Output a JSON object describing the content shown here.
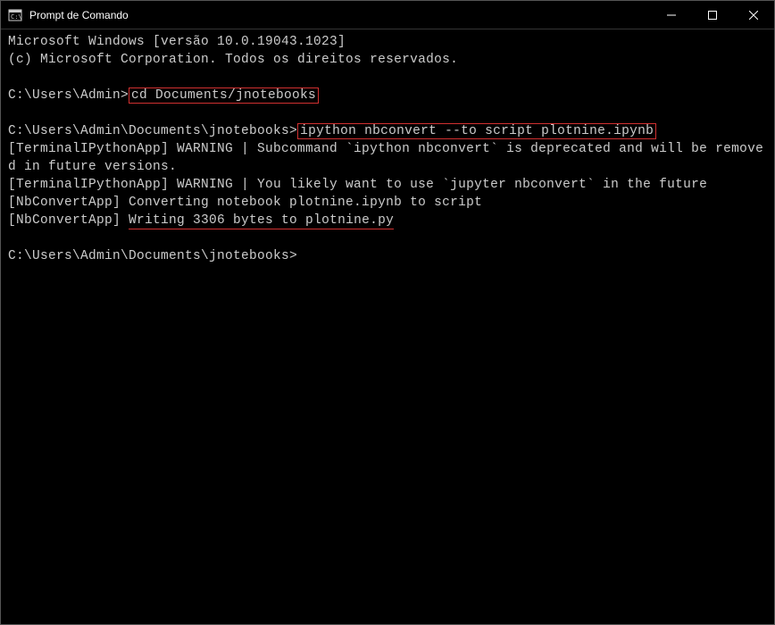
{
  "window": {
    "title": "Prompt de Comando"
  },
  "terminal": {
    "lines": {
      "l1": "Microsoft Windows [versão 10.0.19043.1023]",
      "l2": "(c) Microsoft Corporation. Todos os direitos reservados.",
      "l3_prompt": "C:\\Users\\Admin>",
      "l3_cmd": "cd Documents/jnotebooks",
      "l4_prompt": "C:\\Users\\Admin\\Documents\\jnotebooks>",
      "l4_cmd": "ipython nbconvert --to script plotnine.ipynb",
      "l5": "[TerminalIPythonApp] WARNING | Subcommand `ipython nbconvert` is deprecated and will be removed in future versions.",
      "l6": "[TerminalIPythonApp] WARNING | You likely want to use `jupyter nbconvert` in the future",
      "l7": "[NbConvertApp] Converting notebook plotnine.ipynb to script",
      "l8a": "[NbConvertApp] ",
      "l8b": "Writing 3306 bytes to plotnine.py",
      "l9_prompt": "C:\\Users\\Admin\\Documents\\jnotebooks>"
    }
  }
}
